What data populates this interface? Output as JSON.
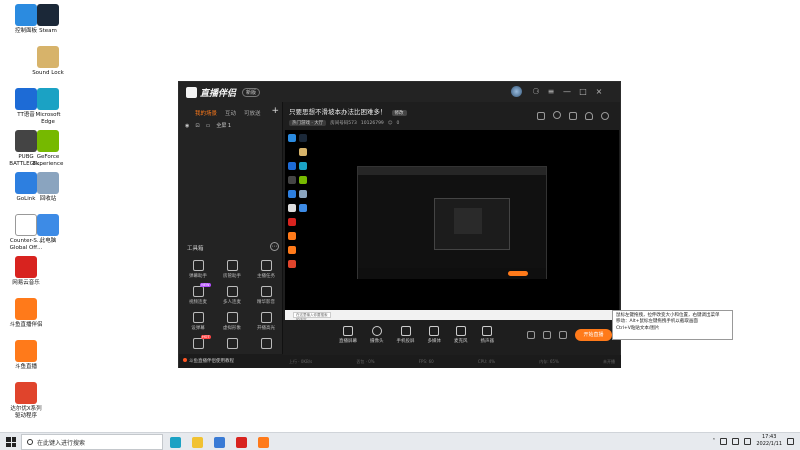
{
  "desktop": {
    "icons": [
      {
        "label": "控制面板",
        "color": "#2b8be0"
      },
      {
        "label": "Steam",
        "color": "#1b2838"
      },
      {
        "label": "Sound Lock",
        "color": "#d7b36a"
      },
      {
        "label": "TT语音",
        "color": "#1d6bd6"
      },
      {
        "label": "Microsoft\nEdge",
        "color": "#1ba2c4"
      },
      {
        "label": "PUBG\nBATTLEGR...",
        "color": "#444444"
      },
      {
        "label": "GeForce\nExperience",
        "color": "#76b900"
      },
      {
        "label": "GoLink",
        "color": "#2d7fe0"
      },
      {
        "label": "回收站",
        "color": "#8aa4bf"
      },
      {
        "label": "Counter-S...\nGlobal Off...",
        "color": "#ffffff"
      },
      {
        "label": "此电脑",
        "color": "#3d8be6"
      },
      {
        "label": "网易云音乐",
        "color": "#d8231f"
      },
      {
        "label": "斗鱼直播伴侣",
        "color": "#ff7a1a"
      },
      {
        "label": "斗鱼直播",
        "color": "#ff7a1a"
      },
      {
        "label": "达尔优X系列\n驱动程序",
        "color": "#e0442c"
      }
    ]
  },
  "app": {
    "brand": "直播伴侣",
    "badge": "新版",
    "window_buttons": [
      "≡",
      "—",
      "□",
      "×"
    ],
    "left_tabs": [
      "我的场景",
      "互动",
      "可放送"
    ],
    "add_scene": "+",
    "scene_name": "全屏 1",
    "tools_title": "工具箱",
    "tools": [
      {
        "label": "弹幕助手",
        "tag": ""
      },
      {
        "label": "房管助手",
        "tag": ""
      },
      {
        "label": "主播任务",
        "tag": ""
      },
      {
        "label": "视频连麦",
        "tag": "NEW"
      },
      {
        "label": "多人连麦",
        "tag": ""
      },
      {
        "label": "精华影音",
        "tag": ""
      },
      {
        "label": "设弹幕",
        "tag": ""
      },
      {
        "label": "虚拟形象",
        "tag": ""
      },
      {
        "label": "开播高光",
        "tag": ""
      },
      {
        "label": "",
        "tag": "HOT"
      },
      {
        "label": "",
        "tag": ""
      },
      {
        "label": "",
        "tag": ""
      }
    ],
    "left_status": "斗鱼直播伴侣使用教程",
    "room": {
      "title": "只要思想不滑坡本办法比困难多！",
      "edit": "修改",
      "category": "热门游戏 · 大厅",
      "room_id": "房间号码573",
      "fans": "10126799",
      "online": "0"
    },
    "controls": [
      "直播屏幕",
      "摄像头",
      "手机投屏",
      "多媒体",
      "麦克风",
      "扬声器"
    ],
    "start_live": "开始直播",
    "status_bar": [
      "上行 · 0KB/s",
      "丢包 · 0%",
      "FPS: 60",
      "CPU: 4%",
      "内存: 65%",
      "未开播"
    ],
    "preview_search": "在这里输入你要搜索的内容"
  },
  "tooltip": {
    "lines": [
      "鼠标左键拖拽，拉伸改变大小和位置，右键调出菜单",
      "移动：Alt+鼠标左键拖拽手机以截取画面",
      "Ctrl+V粘贴文本/图片"
    ]
  },
  "taskbar": {
    "search_placeholder": "在此键入进行搜索",
    "apps": [
      {
        "name": "edge-icon",
        "color": "#1ba2c4"
      },
      {
        "name": "explorer-icon",
        "color": "#f1c232"
      },
      {
        "name": "store-icon",
        "color": "#3a7bd5"
      },
      {
        "name": "netease-icon",
        "color": "#d8231f"
      },
      {
        "name": "douyu-icon",
        "color": "#ff7a1a"
      }
    ],
    "time": "17:43",
    "date": "2022/1/11"
  }
}
